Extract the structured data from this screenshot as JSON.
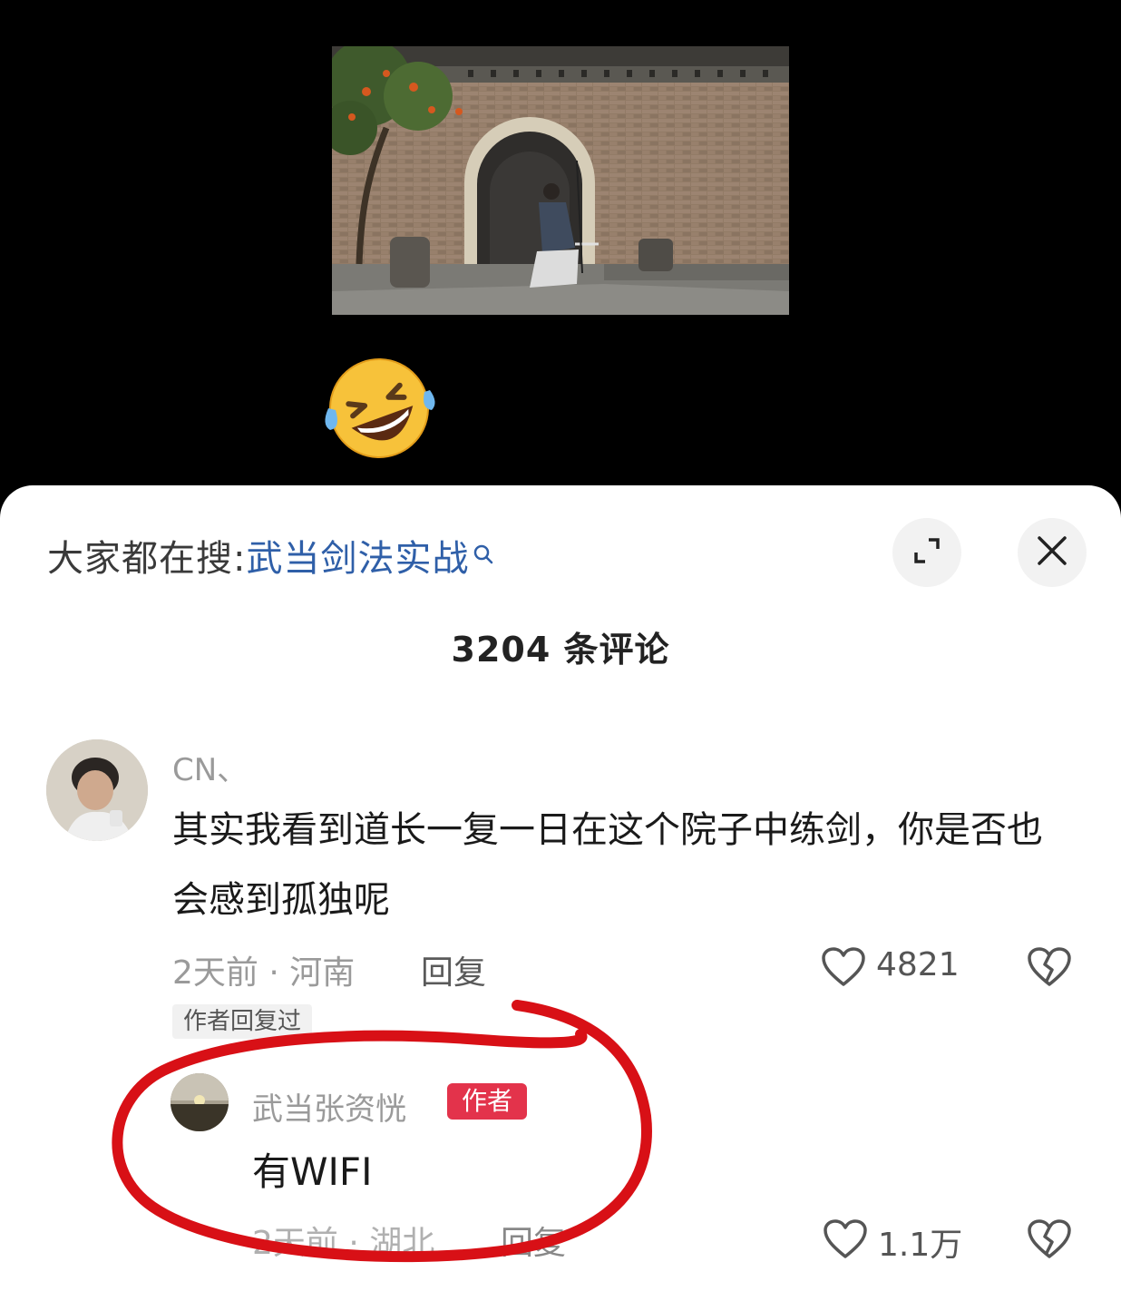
{
  "hot_search": {
    "prefix": "大家都在搜:",
    "keyword": "武当剑法实战"
  },
  "comment_count_label": "3204 条评论",
  "comments": [
    {
      "username": "CN、",
      "text": "其实我看到道长一复一日在这个院子中练剑，你是否也会感到孤独呢",
      "meta": "2天前 · 河南",
      "reply_label": "回复",
      "likes": "4821",
      "author_replied_tag": "作者回复过"
    }
  ],
  "reply": {
    "username": "武当张资恍",
    "badge": "作者",
    "text": "有WIFI",
    "meta": "2天前 · 湖北",
    "reply_label": "回复",
    "likes": "1.1万"
  },
  "icons": {
    "search": "search-icon",
    "expand": "expand-icon",
    "close": "close-icon",
    "like": "heart-icon",
    "dislike": "broken-heart-icon",
    "emoji": "rolling-on-floor-laughing-emoji"
  },
  "colors": {
    "keyword": "#2f5fa8",
    "author_badge": "#e3334b",
    "annotation_circle": "#d81016"
  }
}
